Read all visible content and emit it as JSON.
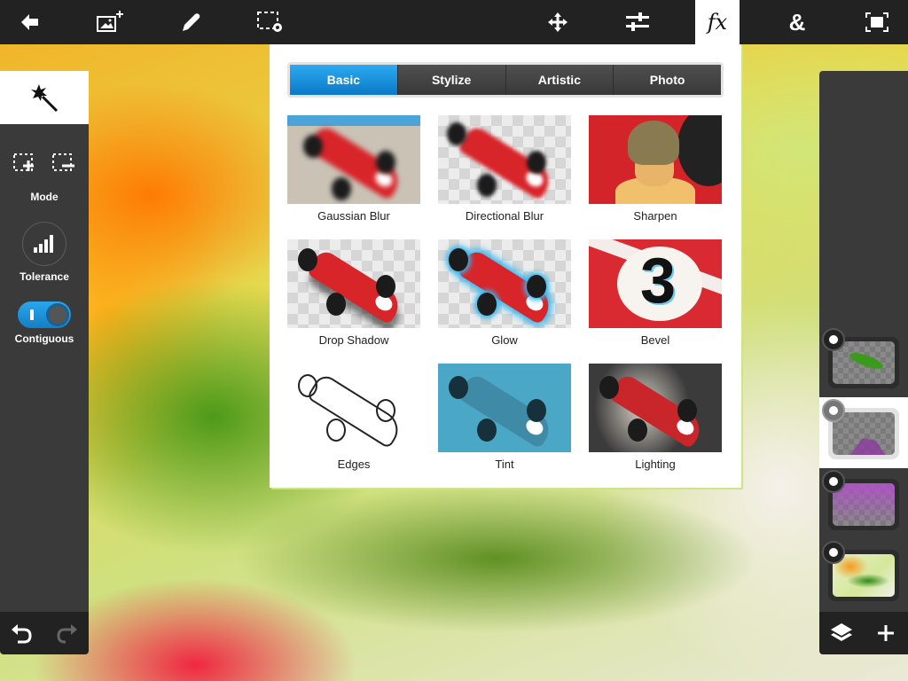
{
  "toolbar": {
    "left": [
      {
        "name": "back",
        "icon": "back-arrow-icon"
      },
      {
        "name": "add-image",
        "icon": "add-image-icon"
      },
      {
        "name": "draw",
        "icon": "pencil-icon"
      },
      {
        "name": "selection-settings",
        "icon": "selection-gear-icon"
      }
    ],
    "right": [
      {
        "name": "move",
        "icon": "move-arrows-icon"
      },
      {
        "name": "adjustments",
        "icon": "sliders-icon"
      },
      {
        "name": "effects",
        "icon": "fx-icon",
        "glyph": "fx",
        "active": true
      },
      {
        "name": "blend",
        "icon": "ampersand-icon",
        "glyph": "&"
      },
      {
        "name": "fullscreen",
        "icon": "fullscreen-icon"
      }
    ]
  },
  "left_panel": {
    "active_tool": "magic-wand-icon",
    "mode_label": "Mode",
    "mode_buttons": [
      "selection-add-icon",
      "selection-subtract-icon"
    ],
    "tolerance_label": "Tolerance",
    "contiguous_label": "Contiguous",
    "contiguous_on": true,
    "undo": "undo-icon",
    "redo": "redo-icon"
  },
  "fx_popup": {
    "tabs": [
      {
        "label": "Basic",
        "active": true
      },
      {
        "label": "Stylize",
        "active": false
      },
      {
        "label": "Artistic",
        "active": false
      },
      {
        "label": "Photo",
        "active": false
      }
    ],
    "effects": [
      {
        "label": "Gaussian Blur"
      },
      {
        "label": "Directional Blur"
      },
      {
        "label": "Sharpen"
      },
      {
        "label": "Drop Shadow"
      },
      {
        "label": "Glow"
      },
      {
        "label": "Bevel",
        "thumb_text": "3"
      },
      {
        "label": "Edges"
      },
      {
        "label": "Tint"
      },
      {
        "label": "Lighting"
      }
    ]
  },
  "layers_panel": {
    "layers": [
      {
        "name": "Chameleon cutout",
        "selected": false
      },
      {
        "name": "Purple shape",
        "selected": true
      },
      {
        "name": "Purple gradient",
        "selected": false
      },
      {
        "name": "Background photo",
        "selected": false
      }
    ],
    "layers_button": "layers-icon",
    "add_button": "plus-icon"
  },
  "colors": {
    "accent": "#1a8fdc",
    "toolbar_bg": "#222222",
    "panel_bg": "#3a3a3a"
  }
}
